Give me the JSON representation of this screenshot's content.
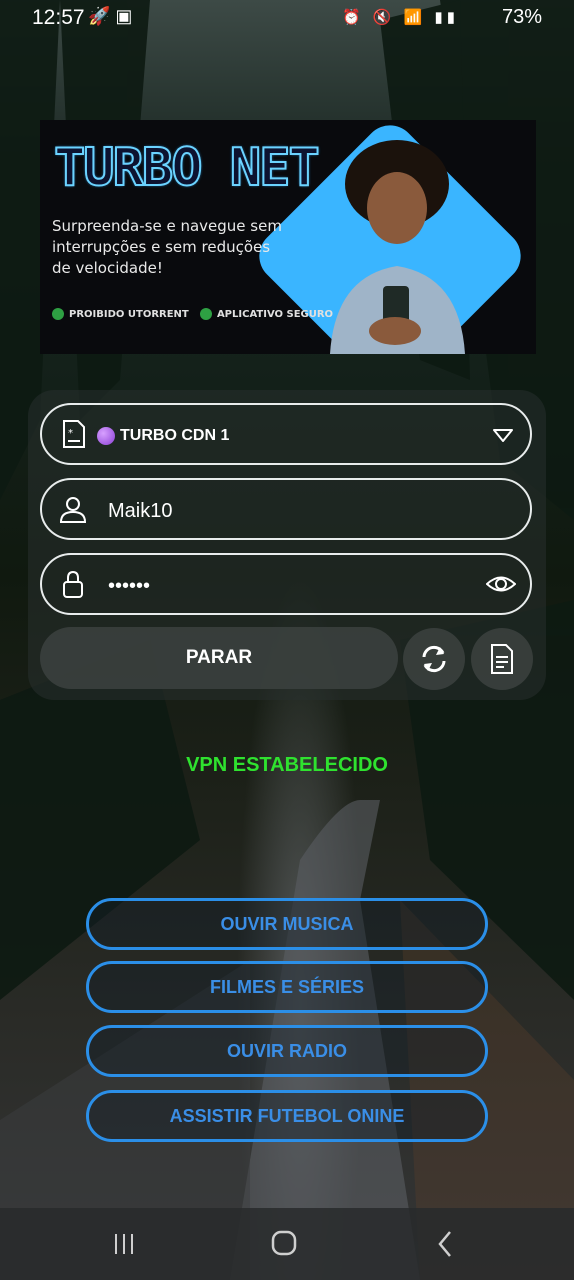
{
  "status_bar": {
    "time": "12:57",
    "battery": "73%"
  },
  "banner": {
    "brand": "TURBO NET",
    "tagline": "Surpreenda-se e navegue sem interrupções e sem reduções de velocidade!",
    "badge_torrent": "PROIBIDO UTORRENT",
    "badge_safe": "APLICATIVO SEGURO",
    "accent_color": "#3ab5ff"
  },
  "form": {
    "server_value": "TURBO CDN 1",
    "username_value": "Maik10",
    "password_value": "••••••",
    "stop_label": "PARAR"
  },
  "vpn_status": "VPN ESTABELECIDO",
  "links": {
    "music": "OUVIR MUSICA",
    "movies": "FILMES E SÉRIES",
    "radio": "OUVIR RADIO",
    "football": "ASSISTIR FUTEBOL ONINE"
  },
  "colors": {
    "status_green": "#2fe22f",
    "link_blue": "#2b8fe8"
  }
}
